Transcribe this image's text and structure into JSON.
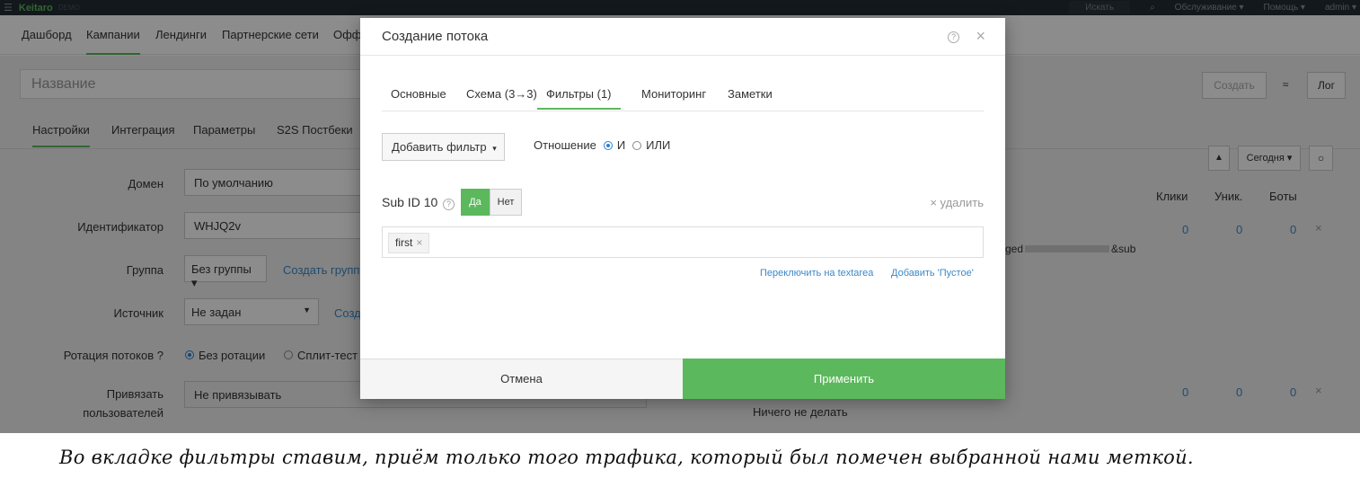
{
  "topbar": {
    "logo": "Keitaro",
    "demo": "DEMO",
    "search": "Искать",
    "service": "Обслуживание ▾",
    "help": "Помощь ▾",
    "user": "admin ▾"
  },
  "mainnav": {
    "items": [
      "Дашборд",
      "Кампании",
      "Лендинги",
      "Партнерские сети",
      "Офф"
    ]
  },
  "campaign": {
    "name_placeholder": "Название",
    "create_btn": "Создать",
    "log_btn": "Лог",
    "tabs": [
      "Настройки",
      "Интеграция",
      "Параметры",
      "S2S Постбеки"
    ],
    "form": {
      "domain_label": "Домен",
      "domain_value": "По умолчанию",
      "id_label": "Идентификатор",
      "id_value": "WHJQ2v",
      "group_label": "Группа",
      "group_value": "Без группы ▾",
      "group_create": "Создать групп",
      "source_label": "Источник",
      "source_value": "Не задан",
      "source_create": "Созд",
      "rotation_label": "Ротация потоков",
      "rotation_opt1": "Без ротации",
      "rotation_opt2": "Сплит-тест",
      "bind_label_1": "Привязать",
      "bind_label_2": "пользователей",
      "bind_value": "Не привязывать"
    },
    "stats": {
      "period": "Сегодня ▾",
      "col_clicks": "Клики",
      "col_unique": "Уник.",
      "col_bots": "Боты",
      "row1": [
        "0",
        "0",
        "0"
      ],
      "row2": [
        "0",
        "0",
        "0"
      ],
      "url_start": "ged",
      "url_end": "&sub",
      "do_nothing": "Ничего не делать"
    }
  },
  "modal": {
    "title": "Создание потока",
    "tabs": [
      "Основные",
      "Схема (3→3)",
      "Фильтры (1)",
      "Мониторинг",
      "Заметки"
    ],
    "add_filter": "Добавить фильтр",
    "relation_label": "Отношение",
    "relation_and": "И",
    "relation_or": "ИЛИ",
    "filter_name": "Sub ID 10",
    "yes": "Да",
    "no": "Нет",
    "remove": "× удалить",
    "tag_value": "first",
    "switch_textarea": "Переключить на textarea",
    "add_empty": "Добавить 'Пустое'",
    "cancel": "Отмена",
    "apply": "Применить"
  },
  "caption": "Во вкладке фильтры ставим, приём только того трафика, который был помечен выбранной нами меткой.",
  "colors": {
    "accent": "#5cb85c",
    "link": "#3a89c9",
    "topbar": "#232c33"
  }
}
